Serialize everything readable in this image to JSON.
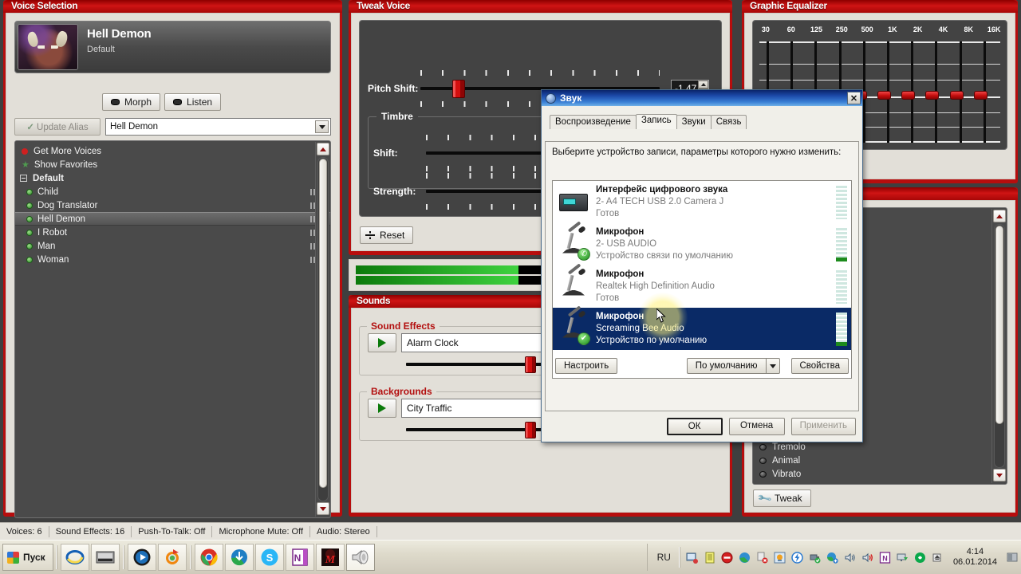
{
  "panels": {
    "voice_selection": {
      "title": "Voice Selection",
      "current_voice": "Hell Demon",
      "current_voice_sub": "Default",
      "morph_label": "Morph",
      "listen_label": "Listen",
      "update_alias_label": "Update Alias",
      "alias_value": "Hell Demon",
      "list": [
        {
          "label": "Get More Voices",
          "type": "link-red"
        },
        {
          "label": "Show Favorites",
          "type": "link-star"
        },
        {
          "label": "Default",
          "type": "group"
        },
        {
          "label": "Child",
          "type": "voice"
        },
        {
          "label": "Dog Translator",
          "type": "voice"
        },
        {
          "label": "Hell Demon",
          "type": "voice",
          "selected": true
        },
        {
          "label": "I Robot",
          "type": "voice"
        },
        {
          "label": "Man",
          "type": "voice"
        },
        {
          "label": "Woman",
          "type": "voice"
        }
      ]
    },
    "tweak_voice": {
      "title": "Tweak Voice",
      "pitch_shift_label": "Pitch Shift:",
      "pitch_shift_value": "-1.47",
      "timbre_label": "Timbre",
      "shift_label": "Shift:",
      "strength_label": "Strength:",
      "reset_label": "Reset"
    },
    "sounds": {
      "title": "Sounds",
      "sound_effects_label": "Sound Effects",
      "sound_effect_value": "Alarm Clock",
      "backgrounds_label": "Backgrounds",
      "background_value": "City Traffic"
    },
    "graphic_equalizer": {
      "title": "Graphic Equalizer",
      "bands": [
        "30",
        "60",
        "125",
        "250",
        "500",
        "1K",
        "2K",
        "4K",
        "8K",
        "16K"
      ],
      "minus_label": "-"
    },
    "effects": {
      "items": [
        "Tremolo",
        "Animal",
        "Vibrato"
      ],
      "tweak_label": "Tweak"
    }
  },
  "statusbar": {
    "cells": [
      "Voices: 6",
      "Sound Effects: 16",
      "Push-To-Talk: Off",
      "Microphone Mute: Off",
      "Audio: Stereo"
    ]
  },
  "taskbar": {
    "start_label": "Пуск",
    "apps": [
      {
        "name": "internet-explorer"
      },
      {
        "name": "media-app"
      },
      {
        "name": "windows-media-player"
      },
      {
        "name": "firefox-variant"
      },
      {
        "name": "google-chrome"
      },
      {
        "name": "download-manager"
      },
      {
        "name": "skype"
      },
      {
        "name": "onenote"
      },
      {
        "name": "mail-ru-agent"
      },
      {
        "name": "morphvox"
      }
    ],
    "tray": {
      "language": "RU",
      "icons": [
        "network-share",
        "notepad",
        "block",
        "globe",
        "flag-error",
        "update",
        "power-flash",
        "usb-safe",
        "network-add",
        "volume",
        "volume-alert",
        "onenote-tray",
        "remote-display",
        "kaspersky",
        "eject"
      ],
      "time": "4:14",
      "date": "06.01.2014"
    }
  },
  "sound_dialog": {
    "title": "Звук",
    "close_label": "✕",
    "tabs": [
      {
        "label": "Воспроизведение",
        "active": false
      },
      {
        "label": "Запись",
        "active": true
      },
      {
        "label": "Звуки",
        "active": false
      },
      {
        "label": "Связь",
        "active": false
      }
    ],
    "instruction": "Выберите устройство записи, параметры которого нужно изменить:",
    "devices": [
      {
        "name": "Интерфейс цифрового звука",
        "desc": "2- A4 TECH USB 2.0 Camera  J",
        "state": "Готов",
        "icon": "digital-audio-interface-icon",
        "badge": "none",
        "selected": false,
        "level": 0
      },
      {
        "name": "Микрофон",
        "desc": "2- USB  AUDIO",
        "state": "Устройство связи по умолчанию",
        "icon": "microphone-icon",
        "badge": "phone-green",
        "selected": false,
        "level": 1
      },
      {
        "name": "Микрофон",
        "desc": "Realtek High Definition Audio",
        "state": "Готов",
        "icon": "microphone-icon",
        "badge": "none",
        "selected": false,
        "level": 0
      },
      {
        "name": "Микрофон",
        "desc": "Screaming Bee Audio",
        "state": "Устройство по умолчанию",
        "icon": "microphone-icon",
        "badge": "check-green",
        "selected": true,
        "level": 1
      }
    ],
    "buttons": {
      "configure": "Настроить",
      "default": "По умолчанию",
      "properties": "Свойства",
      "ok": "ОК",
      "cancel": "Отмена",
      "apply": "Применить"
    }
  },
  "colors": {
    "panel_red": "#b70d0d",
    "header_red": "#cf1414",
    "accent_slider": "#d40f0f",
    "selection_blue": "#0a2a66",
    "titlebar_blue": "#1c49a8",
    "meter_green": "#3fd23f"
  }
}
